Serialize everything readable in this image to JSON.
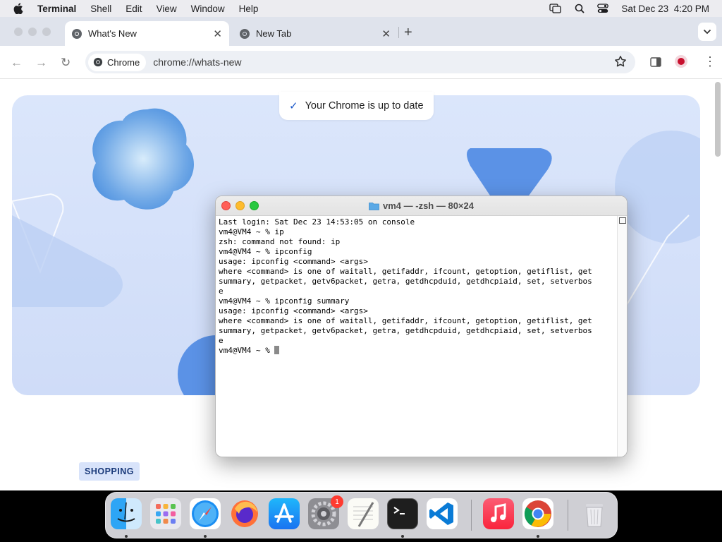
{
  "menubar": {
    "app_name": "Terminal",
    "items": [
      "Shell",
      "Edit",
      "View",
      "Window",
      "Help"
    ],
    "date": "Sat Dec 23",
    "time": "4:20 PM"
  },
  "chrome": {
    "tabs": [
      {
        "title": "What's New",
        "active": true
      },
      {
        "title": "New Tab",
        "active": false
      }
    ],
    "omnibox": {
      "chip_label": "Chrome",
      "url": "chrome://whats-new"
    },
    "page": {
      "toast": "Your Chrome is up to date",
      "section_label": "SHOPPING"
    }
  },
  "terminal": {
    "title": "vm4 — -zsh — 80×24",
    "lines": [
      "Last login: Sat Dec 23 14:53:05 on console",
      "vm4@VM4 ~ % ip",
      "zsh: command not found: ip",
      "vm4@VM4 ~ % ipconfig",
      "usage: ipconfig <command> <args>",
      "where <command> is one of waitall, getifaddr, ifcount, getoption, getiflist, get",
      "summary, getpacket, getv6packet, getra, getdhcpduid, getdhcpiaid, set, setverbos",
      "e",
      "vm4@VM4 ~ % ipconfig summary",
      "usage: ipconfig <command> <args>",
      "where <command> is one of waitall, getifaddr, ifcount, getoption, getiflist, get",
      "summary, getpacket, getv6packet, getra, getdhcpduid, getdhcpiaid, set, setverbos",
      "e"
    ],
    "prompt": "vm4@VM4 ~ % "
  },
  "dock": {
    "apps": [
      "Finder",
      "Launchpad",
      "Safari",
      "Firefox",
      "App Store",
      "System Settings",
      "TextEdit",
      "Terminal",
      "Visual Studio Code",
      "Music",
      "Google Chrome",
      "Trash"
    ],
    "settings_badge": "1"
  },
  "colors": {
    "accent": "#1a73e8",
    "hero_bg": "#d4e1f9",
    "close_red": "#ff5f57",
    "min_yellow": "#febc2e",
    "max_green": "#28c840"
  }
}
